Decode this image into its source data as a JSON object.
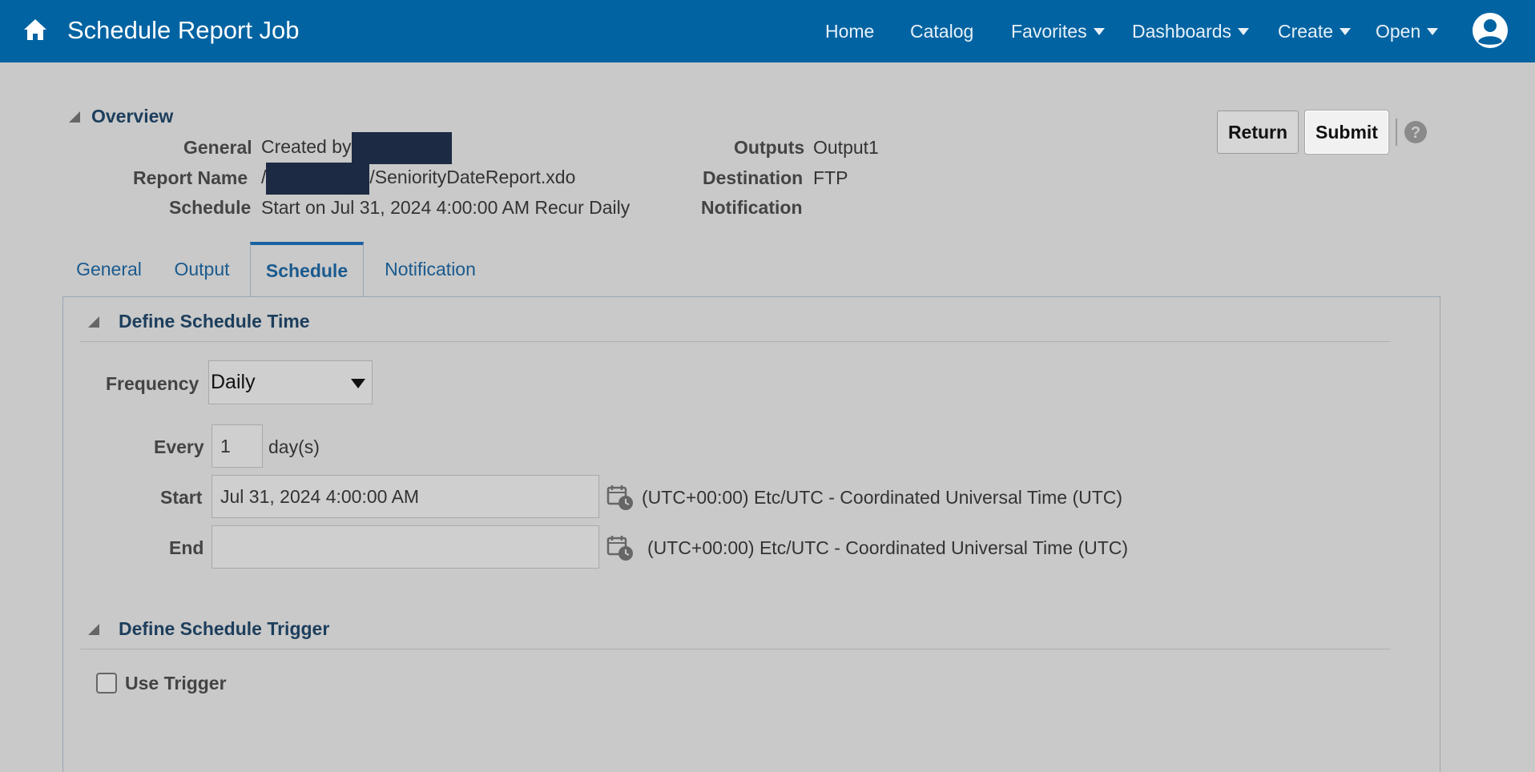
{
  "header": {
    "title": "Schedule Report Job",
    "nav": [
      {
        "label": "Home",
        "has_menu": false
      },
      {
        "label": "Catalog",
        "has_menu": false
      },
      {
        "label": "Favorites",
        "has_menu": true
      },
      {
        "label": "Dashboards",
        "has_menu": true
      },
      {
        "label": "Create",
        "has_menu": true
      },
      {
        "label": "Open",
        "has_menu": true
      }
    ],
    "bar_color": "#0163a2"
  },
  "overview": {
    "heading": "Overview",
    "general_label": "General",
    "general_value": "Created by",
    "report_name_label": "Report Name",
    "report_name_prefix": "/",
    "report_name_suffix": "/SeniorityDateReport.xdo",
    "schedule_label": "Schedule",
    "schedule_value": "Start on Jul 31, 2024 4:00:00 AM Recur Daily",
    "outputs_label": "Outputs",
    "outputs_value": "Output1",
    "destination_label": "Destination",
    "destination_value": "FTP",
    "notification_label": "Notification",
    "notification_value": ""
  },
  "actions": {
    "return_label": "Return",
    "submit_label": "Submit"
  },
  "tabs": [
    {
      "label": "General",
      "active": false
    },
    {
      "label": "Output",
      "active": false
    },
    {
      "label": "Schedule",
      "active": true
    },
    {
      "label": "Notification",
      "active": false
    }
  ],
  "schedule_time": {
    "heading": "Define Schedule Time",
    "frequency_label": "Frequency",
    "frequency_value": "Daily",
    "every_label": "Every",
    "every_value": "1",
    "every_unit": "day(s)",
    "start_label": "Start",
    "start_value": "Jul 31, 2024 4:00:00 AM",
    "start_timezone": "(UTC+00:00) Etc/UTC - Coordinated Universal Time (UTC)",
    "end_label": "End",
    "end_value": "",
    "end_timezone": "(UTC+00:00) Etc/UTC - Coordinated Universal Time (UTC)"
  },
  "schedule_trigger": {
    "heading": "Define Schedule Trigger",
    "use_trigger_label": "Use Trigger",
    "use_trigger_checked": false
  }
}
